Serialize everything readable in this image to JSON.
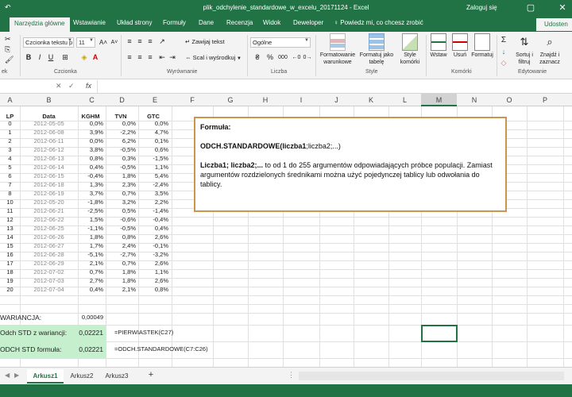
{
  "window": {
    "title": "plik_odchylenie_standardowe_w_excelu_20171124  -  Excel",
    "signin": "Zaloguj się",
    "restore_glyph": "▢",
    "close_glyph": "✕"
  },
  "ribbon_tabs": [
    "Narzędzia główne",
    "Wstawianie",
    "Układ strony",
    "Formuły",
    "Dane",
    "Recenzja",
    "Widok",
    "Deweloper"
  ],
  "active_tab": "Narzędzia główne",
  "tellme": "Powiedz mi, co chcesz zrobić",
  "share": "Udosten",
  "ribbon": {
    "clipboard_label": "ek",
    "font_group_label": "Czcionka",
    "align_group_label": "Wyrównanie",
    "number_group_label": "Liczba",
    "styles_group_label": "Style",
    "cells_group_label": "Komórki",
    "edit_group_label": "Edytowanie",
    "font_name": "Czcionka tekstu p",
    "font_size": "11",
    "bold": "B",
    "italic": "I",
    "underline": "U",
    "wrap_text": "Zawijaj tekst",
    "merge_center": "Scal i wyśrodkuj",
    "number_format": "Ogólne",
    "percent": "%",
    "thousands": "000",
    "cond_format": "Formatowanie warunkowe",
    "format_table": "Formatuj jako tabelę",
    "cell_styles": "Style komórki",
    "insert": "Wstaw",
    "delete": "Usuń",
    "format": "Formatuj",
    "sort_filter": "Sortuj i filtruj",
    "find_select": "Znajdź i zaznacz",
    "sigma": "Σ"
  },
  "formula_bar": {
    "fx": "fx"
  },
  "columns": [
    "A",
    "B",
    "C",
    "D",
    "E",
    "F",
    "G",
    "H",
    "I",
    "J",
    "K",
    "L",
    "M",
    "N",
    "O",
    "P"
  ],
  "selected_column": "M",
  "table": {
    "headers": [
      "LP",
      "Data",
      "KGHM",
      "TVN",
      "GTC"
    ],
    "rows": [
      [
        "0",
        "2012-05-05",
        "0,0%",
        "0,0%",
        "0,0%"
      ],
      [
        "1",
        "2012-06-08",
        "3,9%",
        "-2,2%",
        "4,7%"
      ],
      [
        "2",
        "2012-06-11",
        "0,0%",
        "6,2%",
        "0,1%"
      ],
      [
        "3",
        "2012-06-12",
        "3,8%",
        "-0,5%",
        "0,6%"
      ],
      [
        "4",
        "2012-06-13",
        "0,8%",
        "0,3%",
        "-1,5%"
      ],
      [
        "5",
        "2012-06-14",
        "0,4%",
        "-0,5%",
        "1,1%"
      ],
      [
        "6",
        "2012-06-15",
        "-0,4%",
        "1,8%",
        "5,4%"
      ],
      [
        "7",
        "2012-06-18",
        "1,3%",
        "2,3%",
        "-2,4%"
      ],
      [
        "8",
        "2012-06-19",
        "3,7%",
        "0,7%",
        "3,5%"
      ],
      [
        "10",
        "2012-05-20",
        "-1,8%",
        "3,2%",
        "2,2%"
      ],
      [
        "11",
        "2012-06-21",
        "-2,5%",
        "0,5%",
        "-1,4%"
      ],
      [
        "12",
        "2012-06-22",
        "1,5%",
        "-0,6%",
        "-0,4%"
      ],
      [
        "13",
        "2012-06-25",
        "-1,1%",
        "-0,5%",
        "0,4%"
      ],
      [
        "14",
        "2012-06-26",
        "1,8%",
        "0,8%",
        "2,6%"
      ],
      [
        "15",
        "2012-06-27",
        "1,7%",
        "2,4%",
        "-0,1%"
      ],
      [
        "16",
        "2012-06-28",
        "-5,1%",
        "-2,7%",
        "-3,2%"
      ],
      [
        "17",
        "2012-06-29",
        "2,1%",
        "0,7%",
        "2,6%"
      ],
      [
        "18",
        "2012-07-02",
        "0,7%",
        "1,8%",
        "1,1%"
      ],
      [
        "19",
        "2012-07-03",
        "2,7%",
        "1,8%",
        "2,6%"
      ],
      [
        "20",
        "2012-07-04",
        "0,4%",
        "2,1%",
        "0,8%"
      ]
    ]
  },
  "variance": {
    "label": "WARIANCJA:",
    "value": "0,00049"
  },
  "std_variance": {
    "label": "Odch STD z wariancji:",
    "value": "0,02221",
    "formula": "=PIERWIASTEK(C27)"
  },
  "std_formula": {
    "label": "ODCH STD formuła:",
    "value": "0,02221",
    "formula": "=ODCH.STANDARDOWE(C7:C26)"
  },
  "formula_box": {
    "title": "Formuła:",
    "syntax_bold": "ODCH.STANDARDOWE(liczba1",
    "syntax_rest": ";liczba2;...)",
    "args_bold": "Liczba1; liczba2;...",
    "args_desc": "    to od 1 do 255 argumentów odpowiadających próbce populacji. Zamiast argumentów rozdzielonych średnikami można użyć pojedynczej tablicy lub odwołania do tablicy."
  },
  "sheets": [
    "Arkusz1",
    "Arkusz2",
    "Arkusz3"
  ],
  "active_sheet": "Arkusz1",
  "add_sheet": "+",
  "colors": {
    "excel_green": "#217346",
    "highlight_green": "#c6efce",
    "box_border": "#c9964d"
  }
}
